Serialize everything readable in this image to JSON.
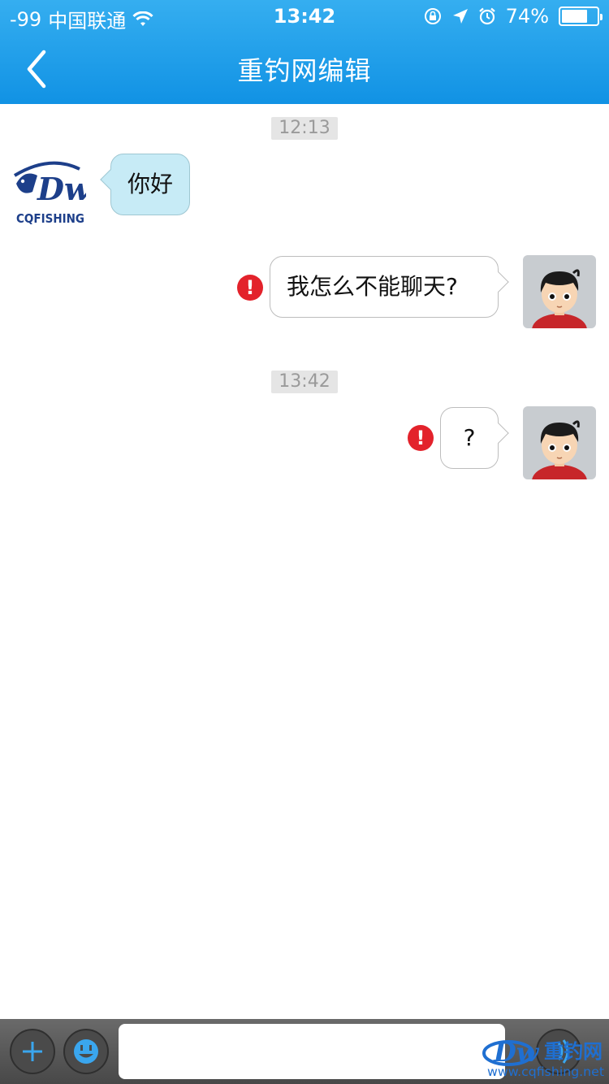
{
  "status_bar": {
    "signal": "-99",
    "carrier": "中国联通",
    "time": "13:42",
    "battery_text": "74%",
    "battery_level": 0.74
  },
  "nav": {
    "title": "重钓网编辑"
  },
  "chat": {
    "messages": [
      {
        "type": "timestamp",
        "text": "12:13"
      },
      {
        "type": "incoming",
        "text": "你好"
      },
      {
        "type": "outgoing",
        "text": "我怎么不能聊天?",
        "failed": true
      },
      {
        "type": "timestamp",
        "text": "13:42"
      },
      {
        "type": "outgoing",
        "text": "?",
        "failed": true
      }
    ]
  },
  "avatar_logo": {
    "text": "CQFISHING",
    "mark": "Dw"
  },
  "input_bar": {
    "value": ""
  },
  "watermark": {
    "title": "重钓网",
    "url": "www.cqfishing.net",
    "mark": "Dw"
  },
  "colors": {
    "nav": "#1a9be8",
    "incoming_bubble": "#c7ebf6",
    "error": "#e3222b"
  },
  "icons": [
    "signal",
    "wifi-icon",
    "rotation-lock-icon",
    "location-icon",
    "alarm-icon",
    "battery-icon",
    "back-icon",
    "error-icon",
    "plus-icon",
    "emoji-icon",
    "voice-icon"
  ]
}
